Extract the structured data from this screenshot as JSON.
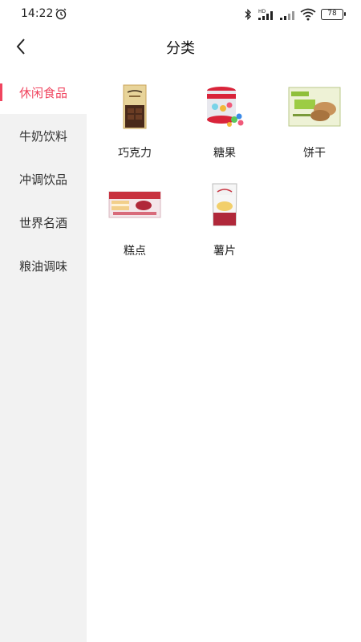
{
  "status": {
    "time": "14:22",
    "network_badge": "HD",
    "battery": "78"
  },
  "header": {
    "title": "分类"
  },
  "sidebar": {
    "items": [
      {
        "label": "休闲食品",
        "active": true
      },
      {
        "label": "牛奶饮料",
        "active": false
      },
      {
        "label": "冲调饮品",
        "active": false
      },
      {
        "label": "世界名酒",
        "active": false
      },
      {
        "label": "粮油调味",
        "active": false
      }
    ]
  },
  "categories": [
    {
      "label": "巧克力",
      "icon": "chocolate-image"
    },
    {
      "label": "糖果",
      "icon": "candy-jar-image"
    },
    {
      "label": "饼干",
      "icon": "biscuit-box-image"
    },
    {
      "label": "糕点",
      "icon": "cake-pack-image"
    },
    {
      "label": "薯片",
      "icon": "chips-bag-image"
    }
  ],
  "colors": {
    "accent": "#f0455f",
    "sidebar_bg": "#f2f2f2"
  }
}
